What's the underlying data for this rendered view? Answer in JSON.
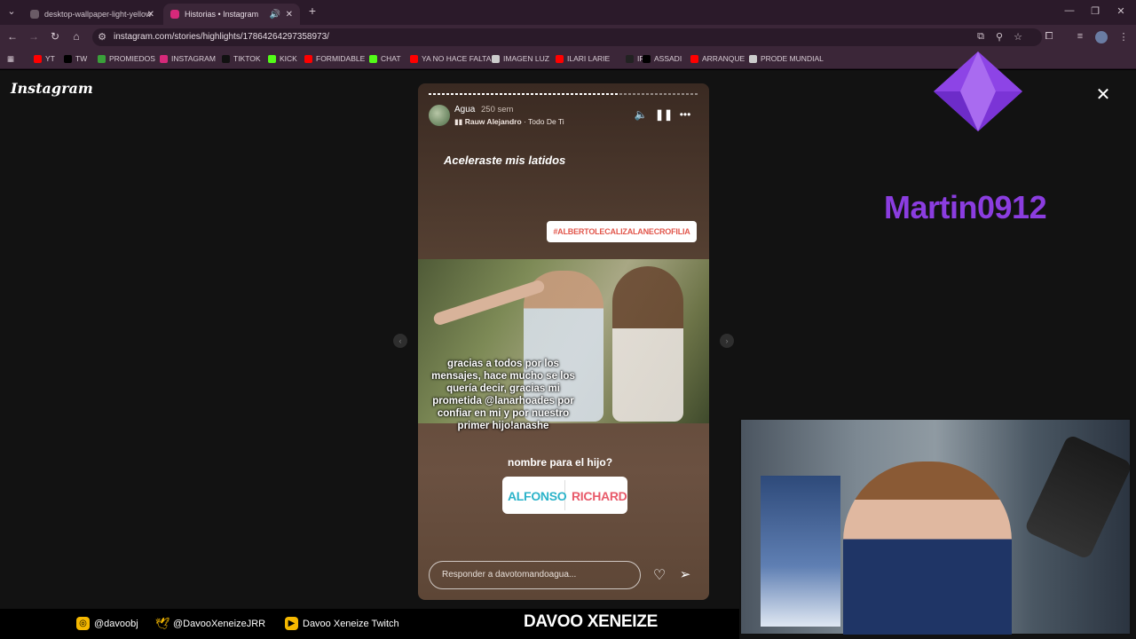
{
  "browser": {
    "tabs": [
      {
        "label": "desktop-wallpaper-light-yellow",
        "active": false,
        "favicon_color": "#6a5b66"
      },
      {
        "label": "Historias • Instagram",
        "active": true,
        "favicon_color": "#d6297a"
      }
    ],
    "new_tab_label": "+",
    "url": "instagram.com/stories/highlights/17864264297358973/",
    "bookmarks": [
      {
        "label": "YT",
        "icon_color": "#ff0000"
      },
      {
        "label": "TW",
        "icon_color": "#000000"
      },
      {
        "label": "PROMIEDOS",
        "icon_color": "#3aa03a"
      },
      {
        "label": "INSTAGRAM",
        "icon_color": "#d6297a"
      },
      {
        "label": "TIKTOK",
        "icon_color": "#111111"
      },
      {
        "label": "KICK",
        "icon_color": "#53fc18"
      },
      {
        "label": "FORMIDABLE",
        "icon_color": "#ff0000"
      },
      {
        "label": "CHAT",
        "icon_color": "#53fc18"
      },
      {
        "label": "YA NO HACE FALTA",
        "icon_color": "#ff0000"
      },
      {
        "label": "IMAGEN LUZ",
        "icon_color": "#cccccc"
      },
      {
        "label": "ILARI LARIE",
        "icon_color": "#ff0000"
      },
      {
        "label": "IR",
        "icon_color": "#222222"
      },
      {
        "label": "ASSADI",
        "icon_color": "#000000"
      },
      {
        "label": "ARRANQUE",
        "icon_color": "#ff0000"
      },
      {
        "label": "PRODE MUNDIAL",
        "icon_color": "#cccccc"
      }
    ]
  },
  "instagram": {
    "logo": "Instagram",
    "story": {
      "username": "Agua",
      "time_ago": "250 sem",
      "music_artist": "Rauw Alejandro",
      "music_song": "· Todo De Ti",
      "progress": 0.7,
      "caption_top": "Aceleraste mis latidos",
      "hashtag": "#ALBERTOLECALIZALANECROFILIA",
      "caption_photo": "gracias a todos por los mensajes, hace mucho se los quería decir, gracias mi prometida @lanarhoades por confiar en mi y por nuestro primer hijo!anashe",
      "question": "nombre para el hijo?",
      "poll_options": [
        {
          "label": "ALFONSO",
          "color": "#2bb3c9"
        },
        {
          "label": "RICHARD",
          "color": "#e85a6a"
        }
      ],
      "reply_placeholder": "Responder a davotomandoagua..."
    }
  },
  "stream": {
    "streamer_name": "Martin0912",
    "socials": [
      {
        "handle": "@davoobj",
        "icon_color": "#f5b800"
      },
      {
        "handle": "@DavooXeneizeJRR",
        "icon_color": "#f5b800"
      },
      {
        "handle": "Davoo Xeneize Twitch",
        "icon_color": "#f5b800"
      }
    ],
    "brand": "DAVOO XENEIZE",
    "accent_color": "#8b3de0"
  }
}
